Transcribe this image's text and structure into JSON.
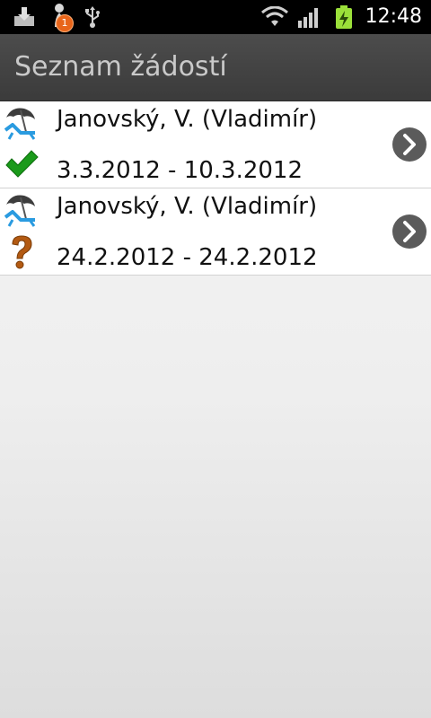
{
  "status_bar": {
    "time": "12:48",
    "notification_count": "1",
    "icons": [
      "download-icon",
      "notification-icon",
      "usb-icon",
      "wifi-icon",
      "signal-icon",
      "battery-charging-icon"
    ]
  },
  "title_bar": {
    "title": "Seznam žádostí"
  },
  "requests": [
    {
      "name": "Janovský, V. (Vladimír)",
      "dates": "3.3.2012 - 10.3.2012",
      "type_icon": "vacation-icon",
      "status_icon": "approved-check-icon",
      "status_color": "#1a9a1a"
    },
    {
      "name": "Janovský, V. (Vladimír)",
      "dates": "24.2.2012 - 24.2.2012",
      "type_icon": "vacation-icon",
      "status_icon": "pending-question-icon",
      "status_color": "#b35a12"
    }
  ],
  "colors": {
    "title_bar": "#444444",
    "title_text": "#c9c9c9",
    "list_bg": "#ffffff",
    "chevron_bg": "#5b5b5b"
  }
}
